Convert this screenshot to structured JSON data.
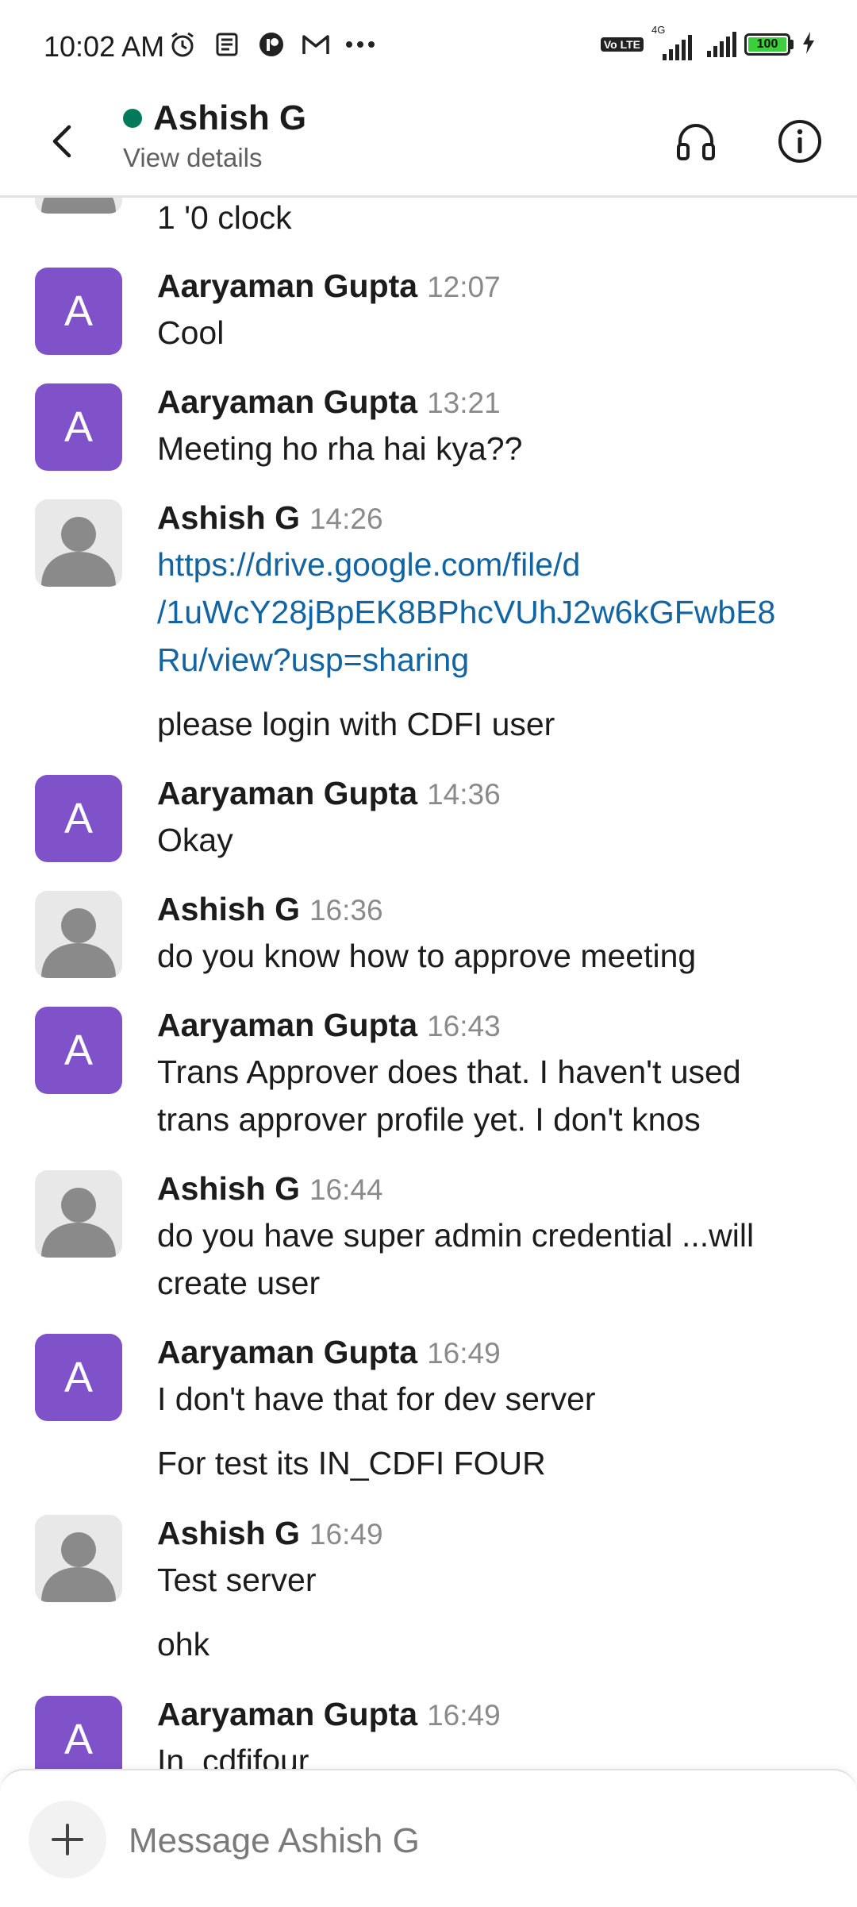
{
  "status_bar": {
    "time": "10:02 AM",
    "network": "4G",
    "volte": "Vo LTE",
    "battery": "100",
    "icons": [
      "alarm-icon",
      "notes-icon",
      "app-icon",
      "gmail-icon",
      "more-icon"
    ]
  },
  "header": {
    "title": "Ashish G",
    "subtitle": "View details",
    "presence_color": "#007a5a"
  },
  "colors": {
    "accent": "#7f52c9",
    "link": "#1264a3"
  },
  "messages": [
    {
      "avatar": "default",
      "lines": [
        "1 '0 clock"
      ],
      "partial": true
    },
    {
      "sender": "Aaryaman Gupta",
      "time": "12:07",
      "avatar": "A",
      "lines": [
        "Cool"
      ]
    },
    {
      "sender": "Aaryaman Gupta",
      "time": "13:21",
      "avatar": "A",
      "lines": [
        "Meeting ho rha hai kya??"
      ]
    },
    {
      "sender": "Ashish G",
      "time": "14:26",
      "avatar": "default",
      "link_lines": [
        "https://drive.google.com/file/d",
        "/1uWcY28jBpEK8BPhcVUhJ2w6kGFwbE8",
        "Ru/view?usp=sharing"
      ],
      "lines": [
        "please login with CDFI user"
      ]
    },
    {
      "sender": "Aaryaman Gupta",
      "time": "14:36",
      "avatar": "A",
      "lines": [
        "Okay"
      ]
    },
    {
      "sender": "Ashish G",
      "time": "16:36",
      "avatar": "default",
      "lines": [
        "do you know how to approve meeting"
      ]
    },
    {
      "sender": "Aaryaman Gupta",
      "time": "16:43",
      "avatar": "A",
      "lines": [
        "Trans Approver does that. I haven't used",
        "trans approver profile yet. I don't knos"
      ]
    },
    {
      "sender": "Ashish G",
      "time": "16:44",
      "avatar": "default",
      "lines": [
        "do you have super admin credential ...will",
        "create user"
      ]
    },
    {
      "sender": "Aaryaman Gupta",
      "time": "16:49",
      "avatar": "A",
      "lines": [
        "I don't have that for dev server",
        "For test its IN_CDFI FOUR"
      ]
    },
    {
      "sender": "Ashish G",
      "time": "16:49",
      "avatar": "default",
      "lines": [
        "Test server",
        "ohk"
      ]
    },
    {
      "sender": "Aaryaman Gupta",
      "time": "16:49",
      "avatar": "A",
      "lines": [
        "In_cdfifour"
      ]
    }
  ],
  "composer": {
    "placeholder": "Message Ashish G"
  }
}
